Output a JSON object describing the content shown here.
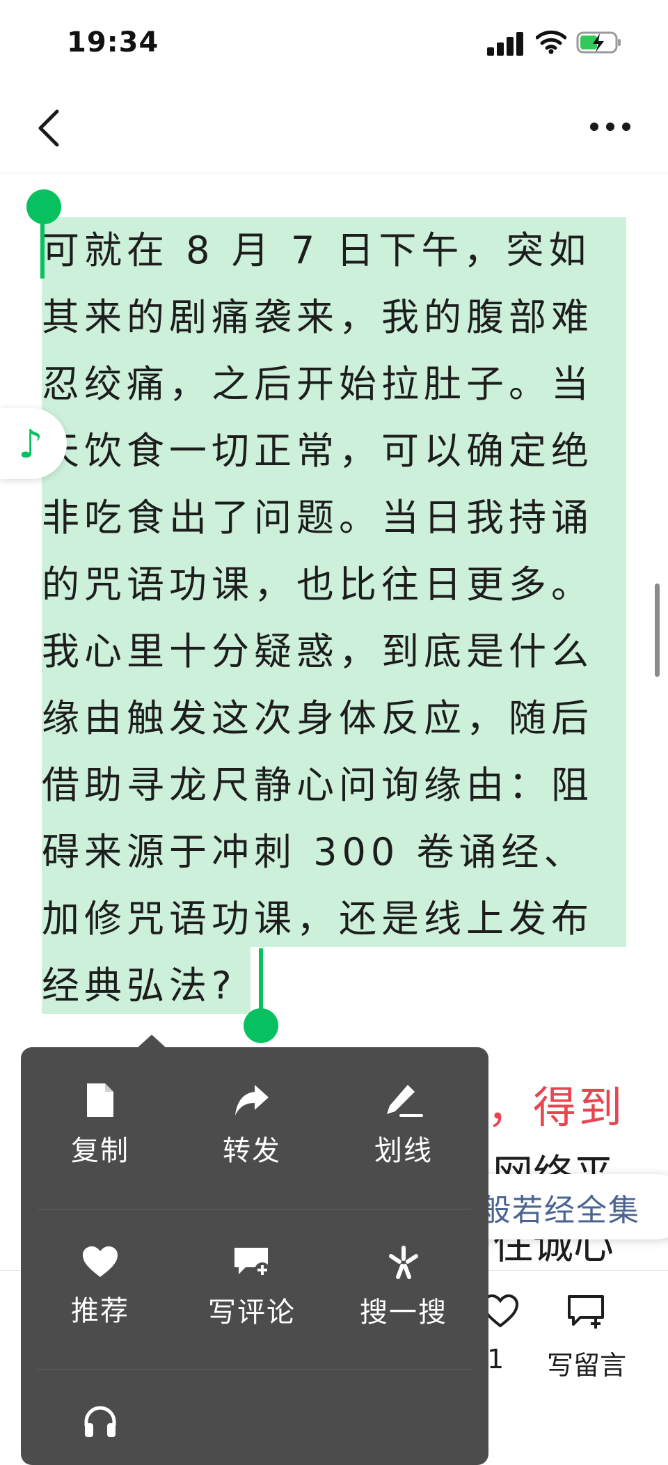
{
  "status_bar": {
    "time": "19:34"
  },
  "article": {
    "lines": [
      "可就在 8 月 7 日下午，突如",
      "其来的剧痛袭来，我的腹部难",
      "忍绞痛，之后开始拉肚子。当",
      "天饮食一切正常，可以确定绝",
      "非吃食出了问题。当日我持诵",
      "的咒语功课，也比往日更多。",
      "我心里十分疑惑，到底是什么",
      "缘由触发这次身体反应，随后",
      "借助寻龙尺静心问询缘由：阻",
      "碍来源于冲刺 300 卷诵经、",
      "加修咒语功课，还是线上发布",
      "经典弘法?"
    ],
    "peek_red": "，得到",
    "peek_line1": "网络平",
    "peek_line2": "住诚心"
  },
  "search_chip": {
    "label": "大般若经全集"
  },
  "context_menu": {
    "items": [
      {
        "label": "复制",
        "icon": "document-icon"
      },
      {
        "label": "转发",
        "icon": "share-arrow-icon"
      },
      {
        "label": "划线",
        "icon": "pen-underline-icon"
      },
      {
        "label": "推荐",
        "icon": "heart-icon"
      },
      {
        "label": "写评论",
        "icon": "comment-add-icon"
      },
      {
        "label": "搜一搜",
        "icon": "search-spark-icon"
      },
      {
        "label": "",
        "icon": "headphones-icon"
      }
    ]
  },
  "bottom_bar": {
    "like_count": "1",
    "comment_label": "写留言"
  },
  "colors": {
    "accent": "#07c160",
    "selection": "#cdf0da",
    "menu_bg": "#4c4c4c",
    "highlight_red": "#e84550"
  }
}
